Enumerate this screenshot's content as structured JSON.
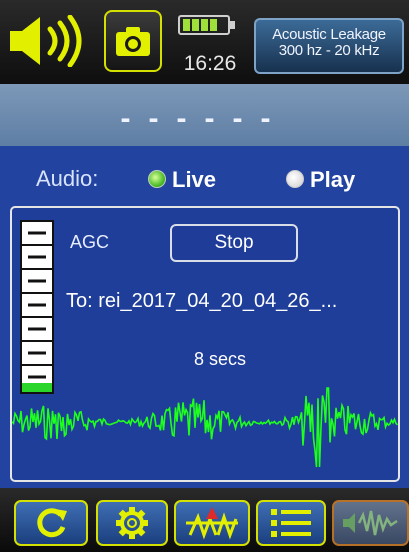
{
  "status_bar": {
    "clock": "16:26",
    "mode_title": "Acoustic Leakage",
    "mode_range": "300 hz - 20 kHz"
  },
  "readout": {
    "value": "------"
  },
  "audio": {
    "label": "Audio:",
    "options": [
      "Live",
      "Play"
    ],
    "selected": "Live"
  },
  "recording": {
    "agc_label": "AGC",
    "stop_label": "Stop",
    "file_label": "To: rei_2017_04_20_04_26_...",
    "duration_label": "8 secs",
    "vu_level_fraction": 0.05
  },
  "toolbar": {
    "icons": [
      "refresh-icon",
      "gear-icon",
      "spectrum-icon",
      "list-icon",
      "waveform-icon"
    ]
  },
  "colors": {
    "accent_yellow": "#d4e000",
    "panel_blue": "#2243a0",
    "waveform_green": "#1eff1e",
    "readout_blue": "#6e8db2"
  }
}
